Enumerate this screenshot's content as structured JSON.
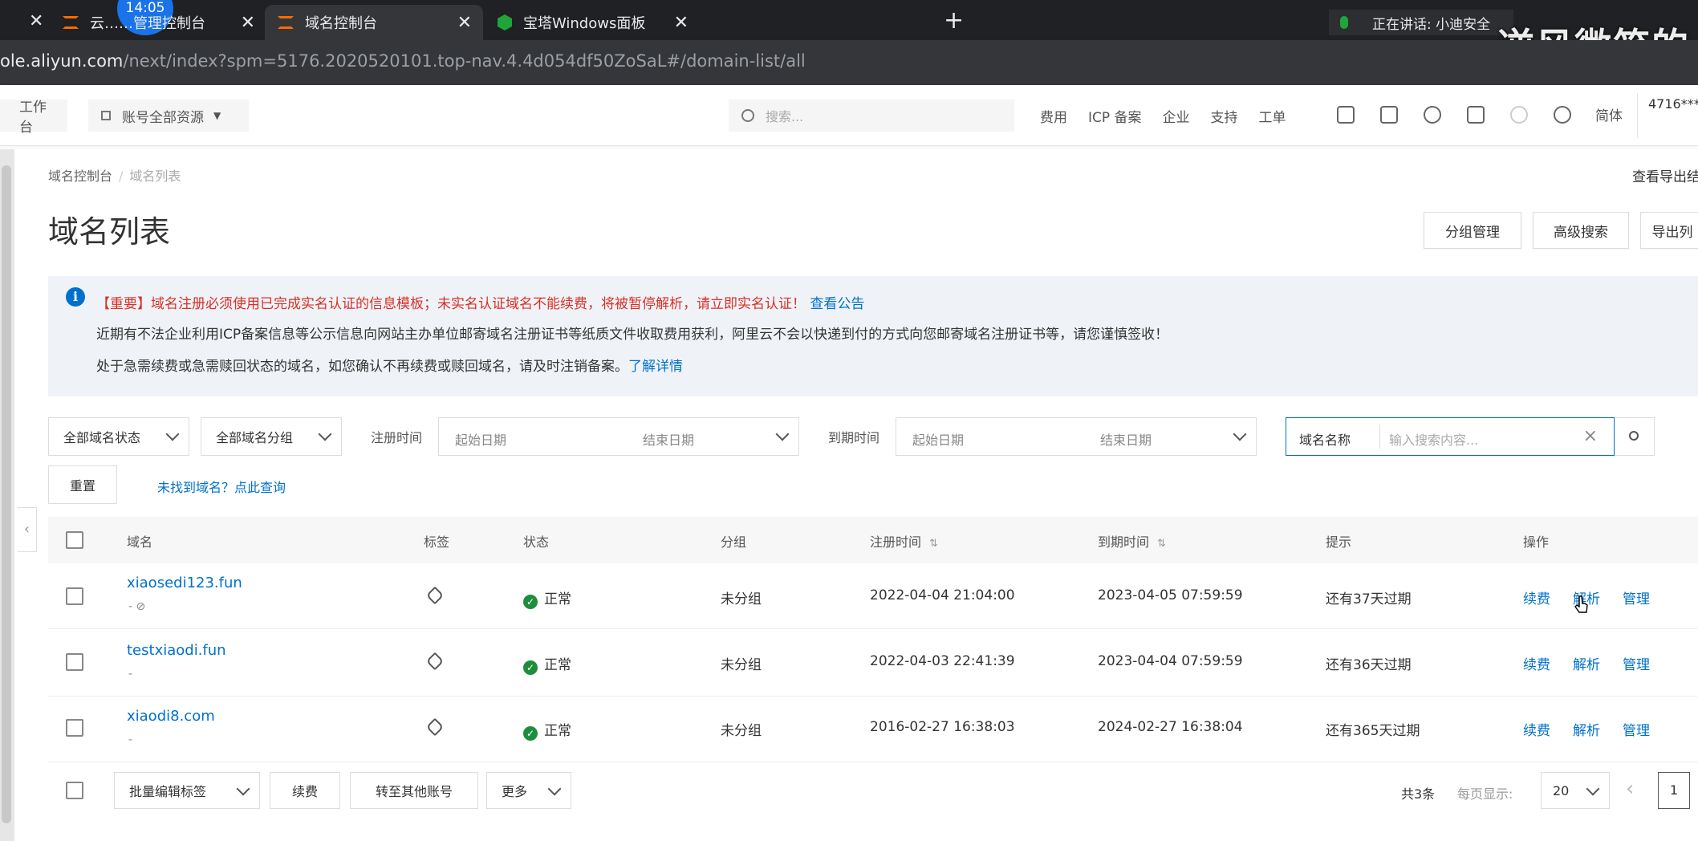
{
  "browser": {
    "clock": "14:05",
    "tabs": [
      {
        "label": "云……管理控制台"
      },
      {
        "label": "域名控制台"
      },
      {
        "label": "宝塔Windows面板"
      }
    ],
    "speaking_text": "正在讲话: 小迪安全",
    "watermark": "逆风微笑的",
    "url_host": "ole.aliyun.com",
    "url_path": "/next/index?spm=5176.2020520101.top-nav.4.4d054df50ZoSaL#/domain-list/all"
  },
  "topnav": {
    "workbench": "工作台",
    "resources": "账号全部资源",
    "search_placeholder": "搜索...",
    "links": [
      "费用",
      "ICP 备案",
      "企业",
      "支持",
      "工单"
    ],
    "lang": "简体",
    "account": "4716***"
  },
  "page": {
    "breadcrumb_root": "域名控制台",
    "breadcrumb_current": "域名列表",
    "export_link": "查看导出结",
    "title": "域名列表",
    "btn_group": "分组管理",
    "btn_advanced": "高级搜索",
    "btn_export": "导出列"
  },
  "notice": {
    "line1_red": "【重要】域名注册必须使用已完成实名认证的信息模板；未实名认证域名不能续费，将被暂停解析，请立即实名认证！",
    "line1_link": "查看公告",
    "line2": "近期有不法企业利用ICP备案信息等公示信息向网站主办单位邮寄域名注册证书等纸质文件收取费用获利，阿里云不会以快递到付的方式向您邮寄域名注册证书等，请您谨慎签收！",
    "line3": "处于急需续费或急需赎回状态的域名，如您确认不再续费或赎回域名，请及时注销备案。",
    "line3_link": "了解详情"
  },
  "filters": {
    "status": "全部域名状态",
    "group": "全部域名分组",
    "reg_label": "注册时间",
    "exp_label": "到期时间",
    "start_placeholder": "起始日期",
    "end_placeholder": "结束日期",
    "search_field": "域名名称",
    "search_placeholder": "输入搜索内容...",
    "reset": "重置",
    "not_found": "未找到域名？点此查询"
  },
  "table": {
    "headers": {
      "domain": "域名",
      "tag": "标签",
      "status": "状态",
      "group": "分组",
      "reg_time": "注册时间",
      "exp_time": "到期时间",
      "hint": "提示",
      "ops": "操作"
    },
    "rows": [
      {
        "domain": "xiaosedi123.fun",
        "sub": "- ⊘",
        "status": "正常",
        "group": "未分组",
        "reg": "2022-04-04 21:04:00",
        "exp": "2023-04-05 07:59:59",
        "hint": "还有37天过期"
      },
      {
        "domain": "testxiaodi.fun",
        "sub": "-",
        "status": "正常",
        "group": "未分组",
        "reg": "2022-04-03 22:41:39",
        "exp": "2023-04-04 07:59:59",
        "hint": "还有36天过期"
      },
      {
        "domain": "xiaodi8.com",
        "sub": "-",
        "status": "正常",
        "group": "未分组",
        "reg": "2016-02-27 16:38:03",
        "exp": "2024-02-27 16:38:04",
        "hint": "还有365天过期"
      }
    ],
    "actions": {
      "renew": "续费",
      "resolve": "解析",
      "manage": "管理"
    }
  },
  "footer": {
    "batch_tag": "批量编辑标签",
    "renew": "续费",
    "transfer": "转至其他账号",
    "more": "更多",
    "total": "共3条",
    "per_page_label": "每页显示:",
    "per_page": "20",
    "page": "1"
  },
  "colors": {
    "link": "#0070cc",
    "warning": "#d93026",
    "success": "#1e8e3e",
    "brand": "#ff6a00"
  }
}
